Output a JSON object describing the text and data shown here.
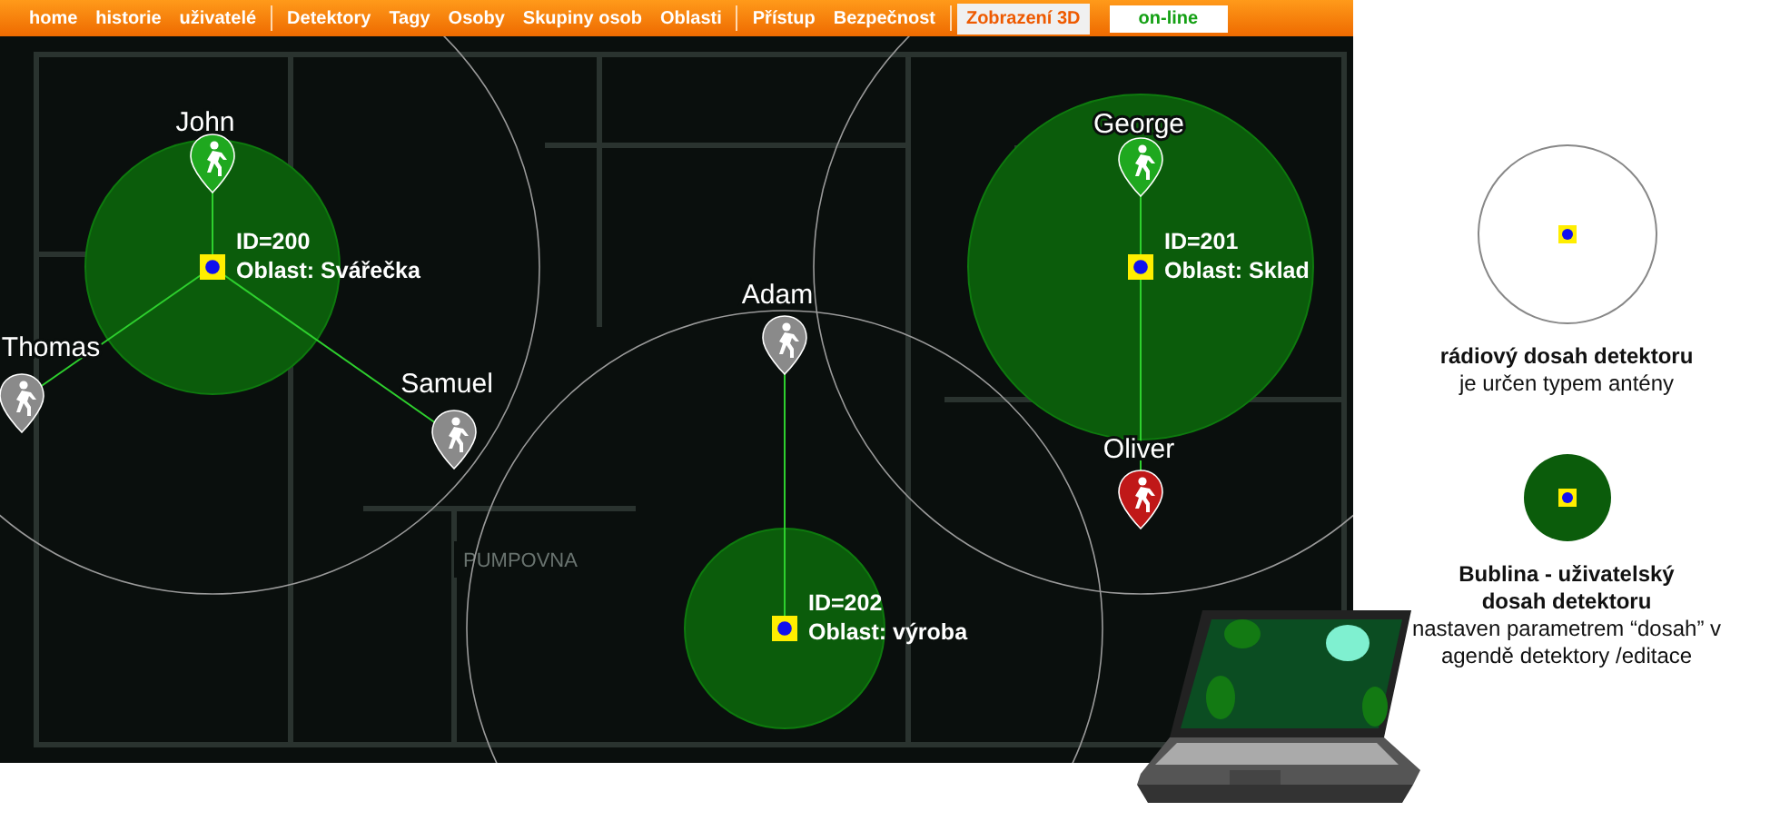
{
  "nav": {
    "groups": [
      [
        {
          "label": "home",
          "selected": false
        },
        {
          "label": "historie",
          "selected": false
        },
        {
          "label": "uživatelé",
          "selected": false
        }
      ],
      [
        {
          "label": "Detektory",
          "selected": false
        },
        {
          "label": "Tagy",
          "selected": false
        },
        {
          "label": "Osoby",
          "selected": false
        },
        {
          "label": "Skupiny osob",
          "selected": false
        },
        {
          "label": "Oblasti",
          "selected": false
        }
      ],
      [
        {
          "label": "Přístup",
          "selected": false
        },
        {
          "label": "Bezpečnost",
          "selected": false
        }
      ],
      [
        {
          "label": "Zobrazení 3D",
          "selected": true
        }
      ]
    ],
    "status": "on-line"
  },
  "map": {
    "room_label": "PUMPOVNA",
    "detectors": [
      {
        "id_label": "ID=200",
        "area": "Oblast: Svářečka"
      },
      {
        "id_label": "ID=201",
        "area": "Oblast: Sklad"
      },
      {
        "id_label": "ID=202",
        "area": "Oblast: výroba"
      }
    ],
    "persons": [
      {
        "name": "John",
        "color": "#1fa81f"
      },
      {
        "name": "Thomas",
        "color": "#8a8a8a"
      },
      {
        "name": "Samuel",
        "color": "#8a8a8a"
      },
      {
        "name": "Adam",
        "color": "#8a8a8a"
      },
      {
        "name": "George",
        "color": "#1fa81f"
      },
      {
        "name": "Oliver",
        "color": "#c01818"
      }
    ]
  },
  "legend": [
    {
      "kind": "radio",
      "title": "rádiový dosah detektoru",
      "text": "je určen typem antény"
    },
    {
      "kind": "bubble",
      "title": "Bublina - uživatelský dosah detektoru",
      "text": "nastaven parametrem “dosah” v agendě detektory /editace"
    }
  ]
}
